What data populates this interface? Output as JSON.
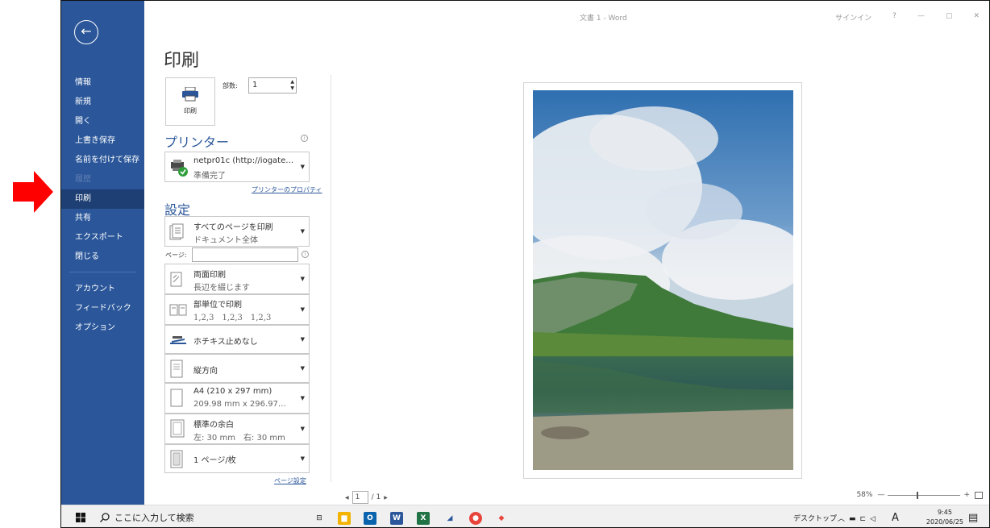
{
  "window": {
    "title": "文書 1 - Word",
    "signin": "サインイン",
    "help": "?",
    "minimize": "—",
    "restore": "▢",
    "close": "✕"
  },
  "sidebar": {
    "back": "←",
    "items": [
      {
        "label": "情報"
      },
      {
        "label": "新規"
      },
      {
        "label": "開く"
      },
      {
        "label": "上書き保存"
      },
      {
        "label": "名前を付けて保存"
      },
      {
        "label": "履歴"
      },
      {
        "label": "印刷"
      },
      {
        "label": "共有"
      },
      {
        "label": "エクスポート"
      },
      {
        "label": "閉じる"
      },
      {
        "label": "アカウント"
      },
      {
        "label": "フィードバック"
      },
      {
        "label": "オプション"
      }
    ]
  },
  "print": {
    "title": "印刷",
    "button": "印刷",
    "copies_label": "部数:",
    "copies_value": "1",
    "printer_title": "プリンター",
    "printer_name": "netpr01c (http://iogate…",
    "printer_status": "準備完了",
    "printer_props": "プリンターのプロパティ",
    "settings_title": "設定",
    "pages_label": "ページ:",
    "pages_value": "",
    "settings": [
      {
        "l1": "すべてのページを印刷",
        "l2": "ドキュメント全体"
      },
      {
        "l1": "両面印刷",
        "l2": "長辺を綴じます"
      },
      {
        "l1": "部単位で印刷",
        "l2": "1,2,3　1,2,3　1,2,3"
      },
      {
        "l1": "ホチキス止めなし",
        "l2": ""
      },
      {
        "l1": "縦方向",
        "l2": ""
      },
      {
        "l1": "A4 (210 x 297 mm)",
        "l2": "209.98 mm x 296.97…"
      },
      {
        "l1": "標準の余白",
        "l2": "左:  30 mm　右:  30 mm"
      },
      {
        "l1": "1 ページ/枚",
        "l2": ""
      }
    ],
    "page_setup": "ページ設定"
  },
  "preview": {
    "page_current": "1",
    "page_total": "/ 1",
    "prev": "◀",
    "next": "▶",
    "zoom": "58%",
    "zoom_minus": "—",
    "zoom_plus": "+"
  },
  "taskbar": {
    "search_placeholder": "ここに入力して検索",
    "desktop": "デスクトップ",
    "ime": "A",
    "time": "9:45",
    "date": "2020/06/25"
  },
  "colors": {
    "word_blue": "#2b579a",
    "active_item": "#1e3f74",
    "arrow": "#ff0000"
  }
}
